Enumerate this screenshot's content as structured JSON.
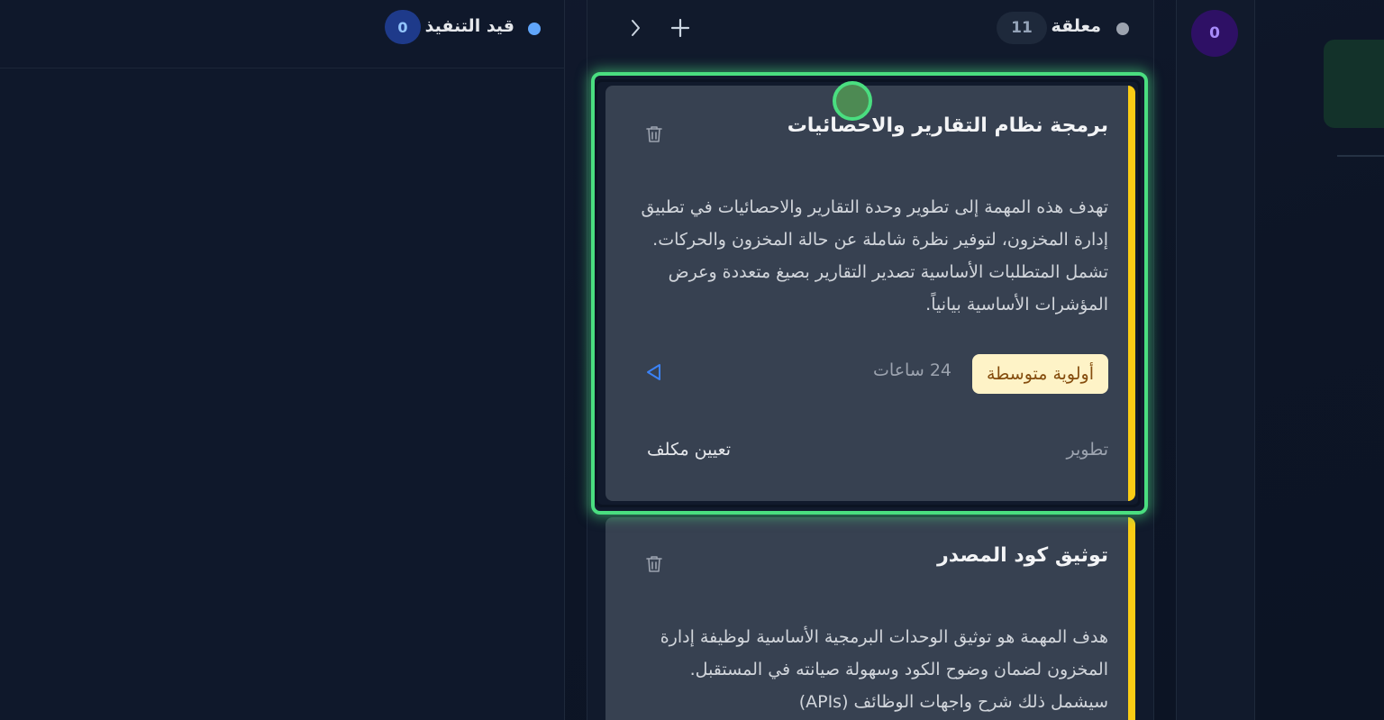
{
  "columns": {
    "in_progress": {
      "title": "قيد التنفيذ",
      "count": "0",
      "dot_color": "#60a5fa"
    },
    "pending": {
      "title": "معلقة",
      "count": "11",
      "dot_color": "#9ca3af"
    },
    "right": {
      "count": "0"
    }
  },
  "cards": [
    {
      "title": "برمجة نظام التقارير والاحصائيات",
      "description": "تهدف هذه المهمة إلى تطوير وحدة التقارير والاحصائيات في تطبيق إدارة المخزون، لتوفير نظرة شاملة عن حالة المخزون والحركات. تشمل المتطلبات الأساسية تصدير التقارير بصيغ متعددة وعرض المؤشرات الأساسية بيانياً.",
      "priority": "أولوية متوسطة",
      "hours": "24 ساعات",
      "category": "تطوير",
      "assign": "تعيين مكلف",
      "accent": "#facc15"
    },
    {
      "title": "توثيق كود المصدر",
      "description": "هدف المهمة هو توثيق الوحدات البرمجية الأساسية لوظيفة إدارة المخزون لضمان وضوح الكود وسهولة صيانته في المستقبل. سيشمل ذلك شرح واجهات الوظائف (APIs)",
      "accent": "#facc15"
    }
  ],
  "icons": {
    "add": "plus-icon",
    "collapse": "chevron-right-icon",
    "delete": "trash-icon",
    "start": "play-icon"
  }
}
